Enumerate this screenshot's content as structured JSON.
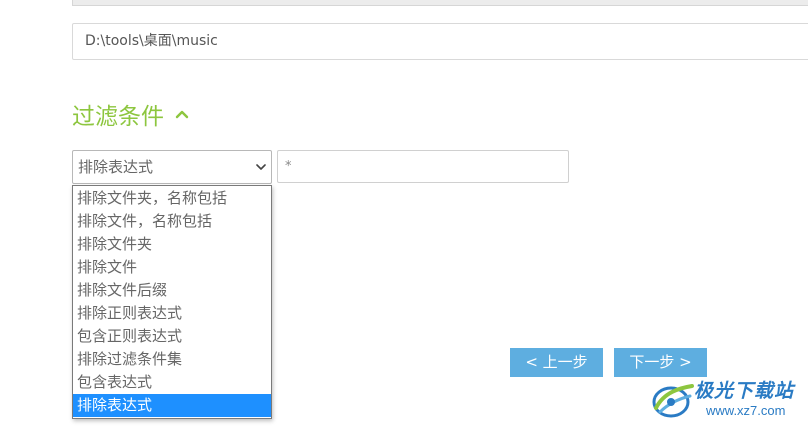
{
  "path_field": {
    "value": "D:\\tools\\桌面\\music"
  },
  "filter_section": {
    "title": "过滤条件",
    "icon": "chevron-up-icon",
    "accent_color": "#8dc63f"
  },
  "filter_type_select": {
    "selected": "排除表达式",
    "options": [
      "排除文件夹，名称包括",
      "排除文件，名称包括",
      "排除文件夹",
      "排除文件",
      "排除文件后缀",
      "排除正则表达式",
      "包含正则表达式",
      "排除过滤条件集",
      "包含表达式",
      "排除表达式"
    ],
    "highlighted_index": 9,
    "highlight_color": "#1e90ff"
  },
  "expression_input": {
    "value": "*"
  },
  "buttons": {
    "prev_label": "< 上一步",
    "next_label": "下一步 >",
    "color": "#5eaee0"
  },
  "watermark": {
    "title": "极光下载站",
    "url": "www.xz7.com"
  }
}
